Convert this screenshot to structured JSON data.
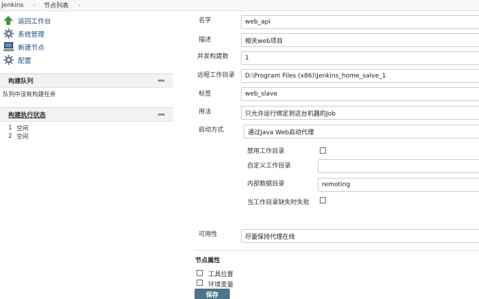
{
  "breadcrumb": {
    "root": "Jenkins",
    "page": "节点列表"
  },
  "tasks": [
    {
      "label": "返回工作台",
      "icon": "up-arrow-icon"
    },
    {
      "label": "系统管理",
      "icon": "gear-icon"
    },
    {
      "label": "新建节点",
      "icon": "computer-icon"
    },
    {
      "label": "配置",
      "icon": "gear-icon"
    }
  ],
  "build_queue": {
    "title": "构建队列",
    "empty_text": "队列中没有构建任务"
  },
  "executor_status": {
    "title": "构建执行状态",
    "rows": [
      {
        "num": "1",
        "state": "空闲"
      },
      {
        "num": "2",
        "state": "空闲"
      }
    ]
  },
  "form": {
    "name": {
      "label": "名字",
      "value": "web_api"
    },
    "description": {
      "label": "描述",
      "value": "相关web项目"
    },
    "executors": {
      "label": "并发构建数",
      "value": "1"
    },
    "remote_dir": {
      "label": "远程工作目录",
      "value": "D:\\Program Files (x86)\\Jenkins_home_salve_1"
    },
    "labels": {
      "label": "标签",
      "value": "web_slave"
    },
    "usage": {
      "label": "用法",
      "value": "只允许运行绑定到这台机器的Job"
    },
    "launch": {
      "label": "启动方式",
      "value": "通过Java Web启动代理"
    },
    "disable_workdir": {
      "label": "禁用工作目录"
    },
    "custom_workdir": {
      "label": "自定义工作目录",
      "value": ""
    },
    "internal_dir": {
      "label": "内部数据目录",
      "value": "remoting"
    },
    "fail_missing": {
      "label": "当工作目录缺失时失败"
    },
    "availability": {
      "label": "可用性",
      "value": "尽量保持代理在线"
    },
    "node_properties": {
      "title": "节点属性"
    },
    "tool_locations": {
      "label": "工具位置"
    },
    "env_vars": {
      "label": "环境变量"
    },
    "save_label": "保存"
  }
}
